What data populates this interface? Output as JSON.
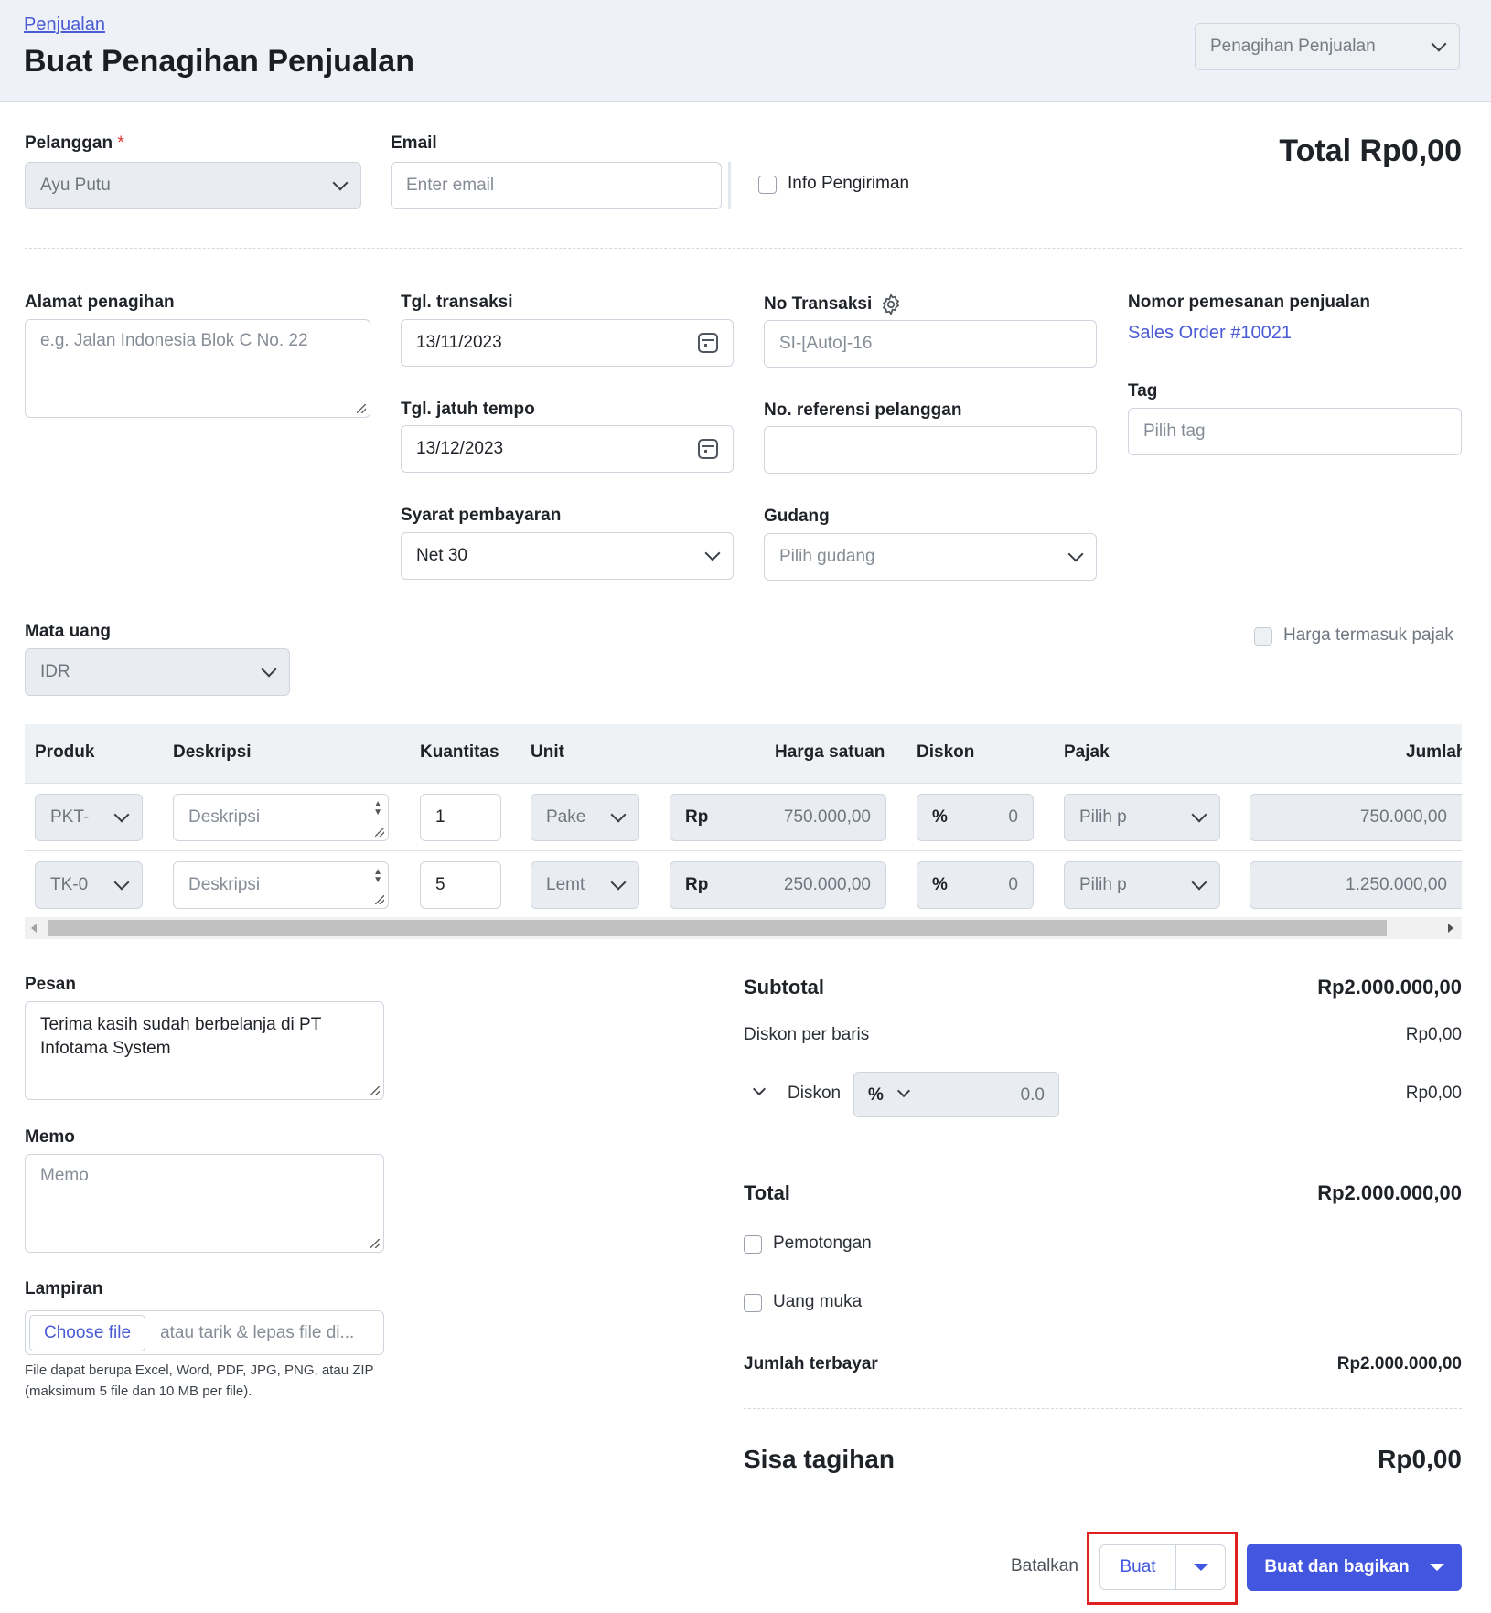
{
  "header": {
    "breadcrumb": "Penjualan",
    "title": "Buat Penagihan Penjualan",
    "doc_type": "Penagihan Penjualan"
  },
  "customer": {
    "label": "Pelanggan",
    "required_mark": "*",
    "value": "Ayu Putu"
  },
  "email": {
    "label": "Email",
    "placeholder": "Enter email"
  },
  "shipping": {
    "label": "Info Pengiriman",
    "checked": false
  },
  "total_top": "Total Rp0,00",
  "billing_address": {
    "label": "Alamat penagihan",
    "placeholder": "e.g. Jalan Indonesia Blok C No. 22"
  },
  "transaction_date": {
    "label": "Tgl. transaksi",
    "value": "13/11/2023"
  },
  "due_date": {
    "label": "Tgl. jatuh tempo",
    "value": "13/12/2023"
  },
  "payment_terms": {
    "label": "Syarat pembayaran",
    "value": "Net 30"
  },
  "transaction_no": {
    "label": "No Transaksi",
    "placeholder": "SI-[Auto]-16"
  },
  "customer_ref": {
    "label": "No. referensi pelanggan",
    "value": ""
  },
  "warehouse": {
    "label": "Gudang",
    "placeholder": "Pilih gudang"
  },
  "sales_order": {
    "label": "Nomor pemesanan penjualan",
    "link": "Sales Order #10021"
  },
  "tag": {
    "label": "Tag",
    "placeholder": "Pilih tag"
  },
  "currency": {
    "label": "Mata uang",
    "value": "IDR"
  },
  "tax_inclusive": {
    "label": "Harga termasuk pajak",
    "checked": false
  },
  "table": {
    "columns": [
      "Produk",
      "Deskripsi",
      "Kuantitas",
      "Unit",
      "Harga satuan",
      "Diskon",
      "Pajak",
      "Jumlah"
    ],
    "rows": [
      {
        "product": "PKT-",
        "description_placeholder": "Deskripsi",
        "qty": "1",
        "unit": "Pake",
        "currency": "Rp",
        "price": "750.000,00",
        "disc_type": "%",
        "disc": "0",
        "tax": "Pilih p",
        "amount": "750.000,00"
      },
      {
        "product": "TK-0",
        "description_placeholder": "Deskripsi",
        "qty": "5",
        "unit": "Lemt",
        "currency": "Rp",
        "price": "250.000,00",
        "disc_type": "%",
        "disc": "0",
        "tax": "Pilih p",
        "amount": "1.250.000,00"
      }
    ]
  },
  "message": {
    "label": "Pesan",
    "line1": "Terima kasih sudah berbelanja di PT",
    "line2": "Infotama System"
  },
  "memo": {
    "label": "Memo",
    "placeholder": "Memo"
  },
  "attachment": {
    "label": "Lampiran",
    "button": "Choose file",
    "hint": "atau tarik & lepas file di...",
    "note1": "File dapat berupa Excel, Word, PDF, JPG, PNG, atau ZIP",
    "note2": "(maksimum 5 file dan 10 MB per file)."
  },
  "summary": {
    "subtotal_label": "Subtotal",
    "subtotal": "Rp2.000.000,00",
    "line_disc_label": "Diskon per baris",
    "line_disc": "Rp0,00",
    "disc_label": "Diskon",
    "disc_type": "%",
    "disc_value": "0.0",
    "disc_amount": "Rp0,00",
    "total_label": "Total",
    "total": "Rp2.000.000,00",
    "withholding_label": "Pemotongan",
    "deposit_label": "Uang muka",
    "paid_label": "Jumlah terbayar",
    "paid": "Rp2.000.000,00",
    "balance_label": "Sisa tagihan",
    "balance": "Rp0,00"
  },
  "actions": {
    "cancel": "Batalkan",
    "create": "Buat",
    "create_share": "Buat dan bagikan"
  },
  "colors": {
    "accent": "#4a5bd4",
    "primary_button": "#4356e0",
    "highlight": "#e0201f"
  }
}
